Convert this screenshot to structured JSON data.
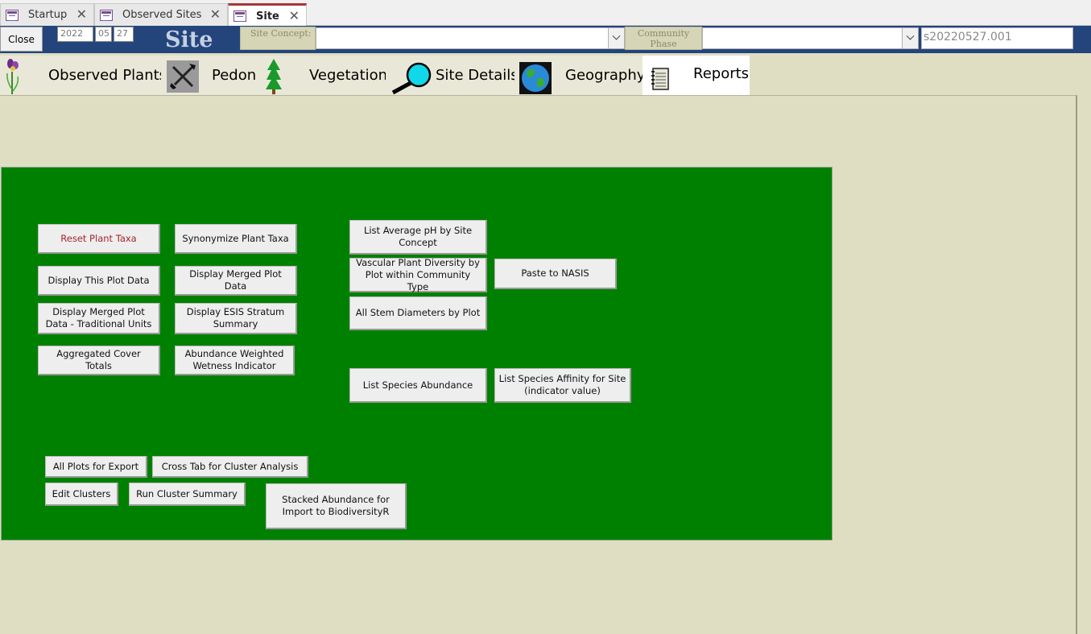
{
  "doc_tabs": [
    {
      "label": "Startup",
      "close": "✕"
    },
    {
      "label": "Observed Sites",
      "close": "✕"
    },
    {
      "label": "Site",
      "close": "✕"
    }
  ],
  "header": {
    "close_label": "Close",
    "year": "2022",
    "month": "05",
    "day": "27",
    "title": "Site",
    "site_concept_label": "Site Concept:",
    "site_concept_value": "",
    "community_phase_label": "Community Phase",
    "community_phase_value": "",
    "site_id": "s20220527.001"
  },
  "nav_tabs": [
    {
      "label": "Observed Plants",
      "icon": "iris-flower-icon"
    },
    {
      "label": "Pedon",
      "icon": "shovel-pick-icon"
    },
    {
      "label": "Vegetation",
      "icon": "pine-tree-icon"
    },
    {
      "label": "Site Details",
      "icon": "magnifier-icon"
    },
    {
      "label": "Geography",
      "icon": "globe-icon"
    },
    {
      "label": "Reports",
      "icon": "notebook-icon"
    }
  ],
  "buttons": {
    "reset_plant_taxa": "Reset Plant Taxa",
    "synonymize_plant_taxa": "Synonymize Plant Taxa",
    "list_average_ph": "List Average pH by Site Concept",
    "display_this_plot": "Display This Plot Data",
    "display_merged_plot": "Display Merged Plot Data",
    "vascular_plant_diversity": "Vascular Plant Diversity by Plot within Community Type",
    "paste_to_nasis": "Paste to NASIS",
    "display_merged_traditional": "Display Merged Plot Data - Traditional Units",
    "display_esis_stratum": "Display ESIS Stratum Summary",
    "all_stem_diameters": "All Stem Diameters by Plot",
    "aggregated_cover": "Aggregated Cover Totals",
    "abundance_weighted": "Abundance Weighted Wetness Indicator",
    "list_species_abundance": "List Species Abundance",
    "list_species_affinity": "List Species Affinity for Site (indicator value)",
    "all_plots_export": "All Plots for Export",
    "cross_tab_cluster": "Cross Tab for Cluster Analysis",
    "edit_clusters": "Edit Clusters",
    "run_cluster_summary": "Run Cluster Summary",
    "stacked_abundance": "Stacked Abundance for Import to  BiodiversityR"
  },
  "colors": {
    "header_blue": "#23457c",
    "panel_green": "#008000",
    "background": "#dfdec3",
    "accent_red": "#a4262c"
  }
}
